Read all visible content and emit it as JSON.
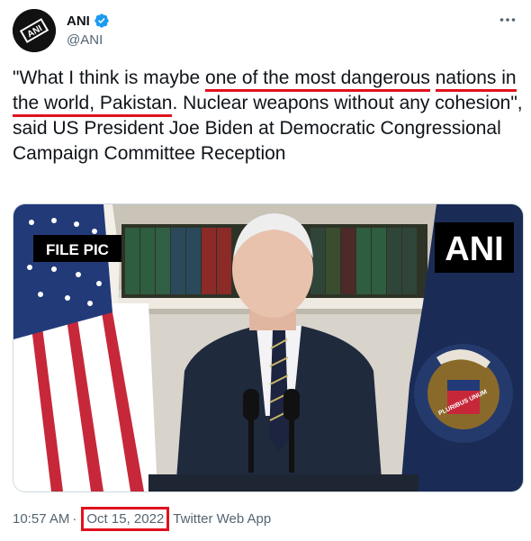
{
  "account": {
    "display_name": "ANI",
    "handle": "@ANI",
    "avatar_icon": "ani-logo-icon",
    "verified_icon": "verified-badge-icon"
  },
  "tweet": {
    "text_parts": [
      "\"What I think is maybe ",
      "one of the most dangerous",
      " ",
      "nations in the world, Pakistan",
      ". Nuclear weapons without any cohesion\", said US President Joe Biden at Democratic Congressional Campaign Committee Reception"
    ],
    "more_icon": "more-options-icon"
  },
  "media": {
    "file_pic_label": "FILE PIC",
    "watermark": "ANI",
    "seal_ribbon_text": "PLURIBUS UNUM"
  },
  "meta": {
    "time": "10:57 AM",
    "separator": "·",
    "date": "Oct 15, 2022",
    "source": "Twitter Web App"
  },
  "colors": {
    "highlight_red": "#e0121e",
    "text": "#0f1419",
    "secondary_text": "#536471",
    "verified_blue": "#1d9bf0"
  }
}
